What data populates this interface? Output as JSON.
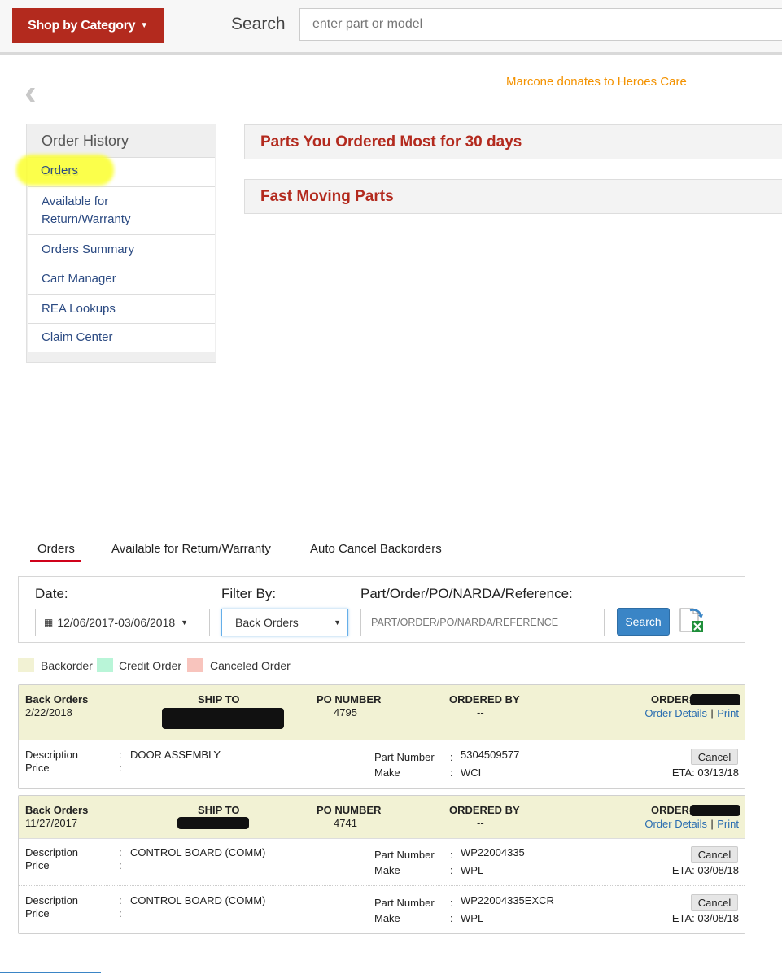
{
  "header": {
    "shop_button": "Shop by Category",
    "search_label": "Search",
    "search_placeholder": "enter part or model",
    "donate_link": "Marcone donates to Heroes Care"
  },
  "sidebar": {
    "heading": "Order History",
    "items": [
      {
        "label": "Orders"
      },
      {
        "label": "Available for\nReturn/Warranty"
      },
      {
        "label": "Orders Summary"
      },
      {
        "label": "Cart Manager"
      },
      {
        "label": "REA Lookups"
      },
      {
        "label": "Claim Center"
      }
    ]
  },
  "panels": {
    "most_ordered": "Parts You Ordered Most for 30 days",
    "fast_moving": "Fast Moving Parts"
  },
  "tabs": [
    {
      "label": "Orders",
      "active": true
    },
    {
      "label": "Available for Return/Warranty"
    },
    {
      "label": "Auto Cancel Backorders"
    }
  ],
  "filters": {
    "date_label": "Date:",
    "date_value": "12/06/2017-03/06/2018",
    "filter_label": "Filter By:",
    "filter_value": "Back Orders",
    "ref_label": "Part/Order/PO/NARDA/Reference:",
    "ref_placeholder": "PART/ORDER/PO/NARDA/REFERENCE",
    "search_button": "Search"
  },
  "legend": {
    "backorder": "Backorder",
    "credit": "Credit Order",
    "canceled": "Canceled Order",
    "colors": {
      "backorder": "#f2f2d4",
      "credit": "#b9f5d8",
      "canceled": "#f8c4bd"
    }
  },
  "orders": [
    {
      "type": "Back Orders",
      "date": "2/22/2018",
      "ship_to_label": "SHIP TO",
      "po_label": "PO NUMBER",
      "po": "4795",
      "ordered_by_label": "ORDERED BY",
      "ordered_by": "--",
      "order_label": "ORDER#",
      "details_link": "Order Details",
      "sep": "|",
      "print_link": "Print",
      "lines": [
        {
          "desc_label": "Description",
          "price_label": "Price",
          "colon": ":",
          "description": "DOOR ASSEMBLY",
          "part_label": "Part Number",
          "make_label": "Make",
          "part": "5304509577",
          "make": "WCI",
          "cancel": "Cancel",
          "eta": "ETA: 03/13/18"
        }
      ]
    },
    {
      "type": "Back Orders",
      "date": "11/27/2017",
      "ship_to_label": "SHIP TO",
      "po_label": "PO NUMBER",
      "po": "4741",
      "ordered_by_label": "ORDERED BY",
      "ordered_by": "--",
      "order_label": "ORDER#",
      "details_link": "Order Details",
      "sep": "|",
      "print_link": "Print",
      "lines": [
        {
          "desc_label": "Description",
          "price_label": "Price",
          "colon": ":",
          "description": "CONTROL BOARD (COMM)",
          "part_label": "Part Number",
          "make_label": "Make",
          "part": "WP22004335",
          "make": "WPL",
          "cancel": "Cancel",
          "eta": "ETA: 03/08/18"
        },
        {
          "desc_label": "Description",
          "price_label": "Price",
          "colon": ":",
          "description": "CONTROL BOARD (COMM)",
          "part_label": "Part Number",
          "make_label": "Make",
          "part": "WP22004335EXCR",
          "make": "WPL",
          "cancel": "Cancel",
          "eta": "ETA: 03/08/18"
        }
      ]
    }
  ]
}
